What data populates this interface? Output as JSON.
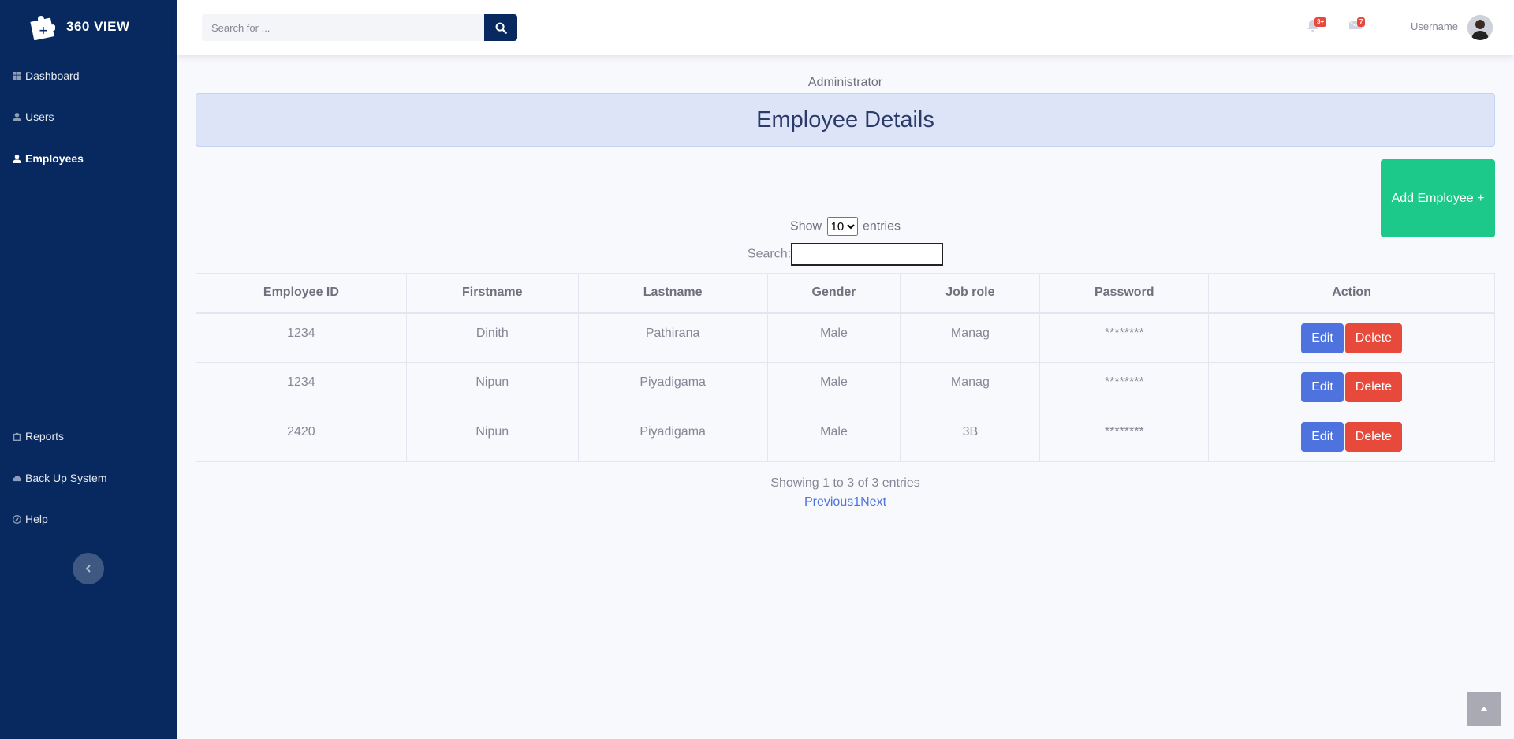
{
  "brand": {
    "name": "360 VIEW",
    "logo_icon": "puzzle-logo-icon"
  },
  "sidebar": {
    "items": [
      {
        "label": "Dashboard",
        "icon": "dashboard-icon"
      },
      {
        "label": "Users",
        "icon": "user-icon"
      },
      {
        "label": "Employees",
        "icon": "user-icon",
        "active": true
      },
      {
        "label": "Reports",
        "icon": "clipboard-icon"
      },
      {
        "label": "Back Up System",
        "icon": "cloud-icon"
      },
      {
        "label": "Help",
        "icon": "compass-icon"
      }
    ]
  },
  "topbar": {
    "search_placeholder": "Search for ...",
    "alerts_badge": "3+",
    "messages_badge": "7",
    "username": "Username"
  },
  "main": {
    "role_label": "Administrator",
    "title": "Employee Details",
    "add_button": "Add Employee +",
    "show_label": "Show",
    "entries_label": "entries",
    "page_length": "10",
    "search_label": "Search:",
    "columns": [
      "Employee ID",
      "Firstname",
      "Lastname",
      "Gender",
      "Job role",
      "Password",
      "Action"
    ],
    "rows": [
      [
        "1234",
        "Dinith",
        "Pathirana",
        "Male",
        "Manag",
        "********"
      ],
      [
        "1234",
        "Nipun",
        "Piyadigama",
        "Male",
        "Manag",
        "********"
      ],
      [
        "2420",
        "Nipun",
        "Piyadigama",
        "Male",
        "3B",
        "********"
      ]
    ],
    "edit_label": "Edit",
    "delete_label": "Delete",
    "info": "Showing 1 to 3 of 3 entries",
    "paging": {
      "previous": "Previous",
      "page": "1",
      "next": "Next"
    }
  },
  "colors": {
    "sidebar": "#08295f",
    "primary": "#4e73df",
    "danger": "#e74a3b",
    "success": "#1cc88a"
  }
}
